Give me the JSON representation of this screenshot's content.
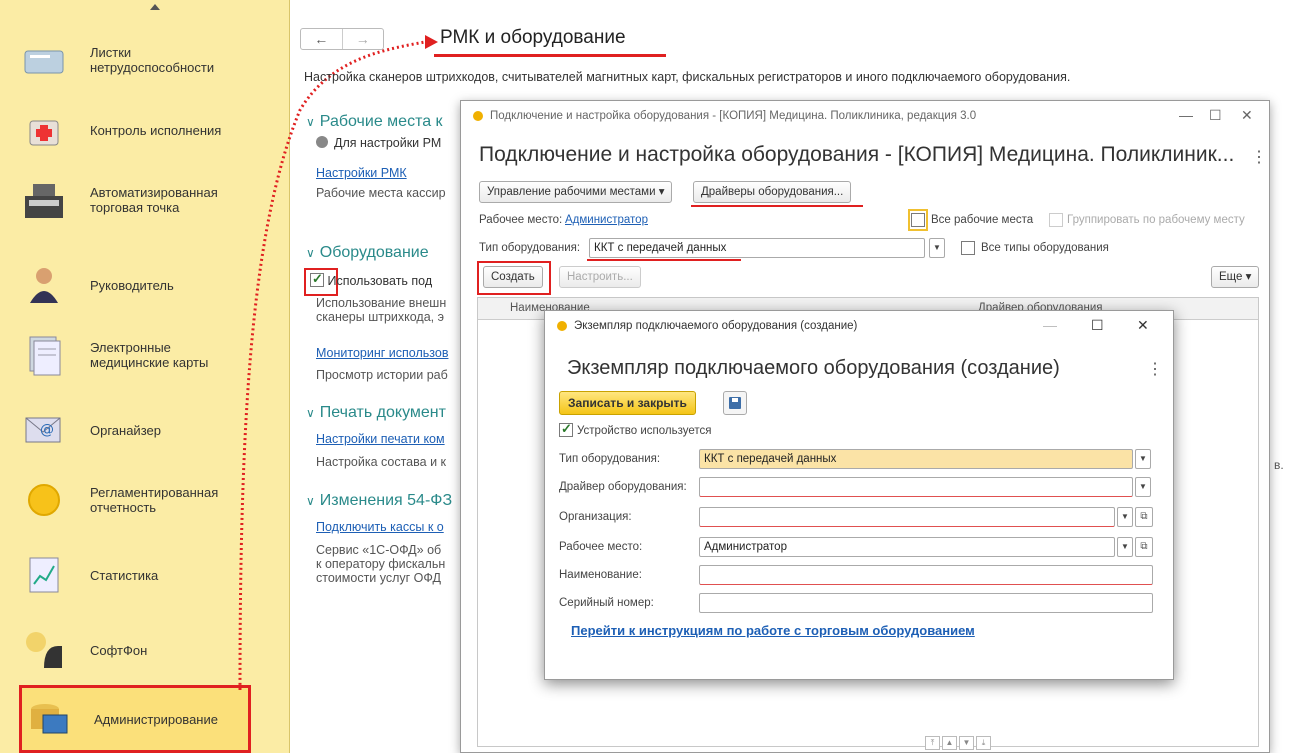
{
  "sidebar": {
    "items": [
      {
        "label": "Листки\nнетрудоспособности",
        "icon": "sick-leave-icon"
      },
      {
        "label": "Контроль исполнения",
        "icon": "medical-case-icon"
      },
      {
        "label": "Автоматизированная\nторговая точка",
        "icon": "cash-register-icon"
      },
      {
        "label": "Руководитель",
        "icon": "manager-icon"
      },
      {
        "label": "Электронные\nмедицинские карты",
        "icon": "medical-records-icon"
      },
      {
        "label": "Органайзер",
        "icon": "email-icon"
      },
      {
        "label": "Регламентированная\nотчетность",
        "icon": "report-circle-icon"
      },
      {
        "label": "Статистика",
        "icon": "statistics-icon"
      },
      {
        "label": "СофтФон",
        "icon": "softphone-icon"
      },
      {
        "label": "Администрирование",
        "icon": "administration-icon"
      }
    ]
  },
  "page": {
    "back": "←",
    "forward": "→",
    "title": "РМК и оборудование",
    "description": "Настройка сканеров штрихкодов, считывателей магнитных карт, фискальных регистраторов и иного подключаемого оборудования.",
    "sections": {
      "workplaces": {
        "title": "Рабочие места к",
        "hint": "Для настройки РМ",
        "link": "Настройки РМК",
        "text": "Рабочие места кассир"
      },
      "equipment": {
        "title": "Оборудование",
        "checkbox": "Использовать под",
        "text": "Использование внешн\nсканеры штрихкода, э",
        "link": "Мониторинг использов",
        "text2": "Просмотр истории раб"
      },
      "print": {
        "title": "Печать документ",
        "link": "Настройки печати ком",
        "text": "Настройка состава и к"
      },
      "changes": {
        "title": "Изменения 54-ФЗ",
        "link": "Подключить кассы к о",
        "text": "Сервис «1С-ОФД» об\nк оператору фискальн\nстоимости услуг ОФД"
      }
    },
    "edge_text": "в."
  },
  "win1": {
    "title": "Подключение и настройка оборудования - [КОПИЯ] Медицина. Поликлиника, редакция 3.0",
    "heading": "Подключение и настройка оборудования - [КОПИЯ] Медицина. Поликлиник...",
    "controls": {
      "min": "—",
      "max": "☐",
      "close": "✕"
    },
    "manage_btn": "Управление рабочими местами ▾",
    "drivers_btn": "Драйверы оборудования...",
    "workplace_label": "Рабочее место:",
    "workplace_value": "Администратор",
    "all_workplaces": "Все рабочие места",
    "group_by": "Группировать по рабочему месту",
    "equip_type_label": "Тип оборудования:",
    "equip_type_value": "ККТ с передачей данных",
    "all_types": "Все типы оборудования",
    "create_btn": "Создать",
    "configure_btn": "Настроить...",
    "more_btn": "Еще ▾",
    "col_name": "Наименование",
    "col_driver": "Драйвер оборудования"
  },
  "win2": {
    "title": "Экземпляр подключаемого оборудования (создание)",
    "heading": "Экземпляр подключаемого оборудования (создание)",
    "save_close": "Записать и закрыть",
    "in_use": "Устройство используется",
    "fields": [
      {
        "label": "Тип оборудования:",
        "value": "ККТ с передачей данных"
      },
      {
        "label": "Драйвер оборудования:",
        "value": ""
      },
      {
        "label": "Организация:",
        "value": ""
      },
      {
        "label": "Рабочее место:",
        "value": "Администратор"
      },
      {
        "label": "Наименование:",
        "value": ""
      },
      {
        "label": "Серийный номер:",
        "value": ""
      }
    ],
    "link": "Перейти к инструкциям по работе с торговым оборудованием"
  },
  "colors": {
    "sidebar_bg": "#fbeca5",
    "accent_red": "#e02020",
    "link": "#1d5fb5",
    "section": "#2a8a8a",
    "save_btn": "#f4c518"
  }
}
